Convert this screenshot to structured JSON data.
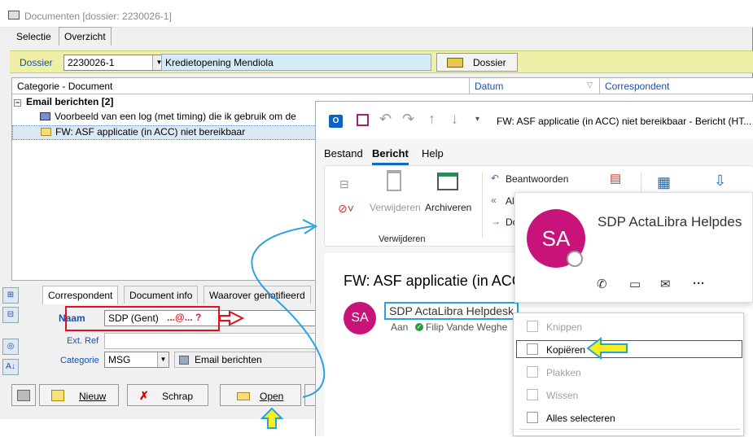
{
  "main_window": {
    "title": "Documenten  [dossier: 2230026-1]",
    "tabs": [
      "Selectie",
      "Overzicht"
    ],
    "dossier": {
      "label": "Dossier",
      "number": "2230026-1",
      "name": "Kredietopening  Mendiola",
      "button": "Dossier"
    },
    "grid": {
      "columns": [
        "Categorie - Document",
        "Datum",
        "Correspondent"
      ],
      "group": "Email berichten [2]",
      "group_toggle": "−",
      "rows": [
        "Voorbeeld van een log (met timing) die ik gebruik om de",
        "FW: ASF applicatie (in ACC) niet bereikbaar"
      ]
    },
    "detail_tabs": [
      "Correspondent",
      "Document info",
      "Waarover genotifieerd"
    ],
    "fields": {
      "naam_label": "Naam",
      "naam_value": "SDP (Gent)",
      "naam_annotation": "...@... ?",
      "extref_label": "Ext. Ref",
      "categorie_label": "Categorie",
      "categorie_value": "MSG",
      "categorie_name": "Email berichten"
    },
    "buttons": [
      "Nieuw",
      "Schrap",
      "Open"
    ]
  },
  "outlook": {
    "window_subject": "FW: ASF applicatie (in ACC) niet bereikbaar  -  Bericht (HT...",
    "tabs": [
      "Bestand",
      "Bericht",
      "Help"
    ],
    "ribbon": {
      "delete": "Verwijderen",
      "archive": "Archiveren",
      "group_label": "Verwijderen",
      "reply": "Beantwoorden",
      "reply_all": "Al",
      "forward": "Do"
    },
    "message": {
      "subject": "FW: ASF applicatie (in ACC",
      "avatar": "SA",
      "sender": "SDP ActaLibra Helpdesk",
      "to_label": "Aan",
      "to": "Filip Vande Weghe"
    },
    "contact_card": {
      "avatar": "SA",
      "name": "SDP ActaLibra Helpdes"
    },
    "context_menu": [
      {
        "label": "Knippen",
        "enabled": false
      },
      {
        "label": "Kopiëren",
        "enabled": true
      },
      {
        "label": "Plakken",
        "enabled": false
      },
      {
        "label": "Wissen",
        "enabled": false
      },
      {
        "label": "Alles selecteren",
        "enabled": true
      }
    ]
  },
  "colors": {
    "dossier_bar": "#eef0a8",
    "accent_blue": "#1a4fb0",
    "avatar": "#c8137b",
    "annotation_red": "#e0101e",
    "annotation_yellow": "#f7ee1e",
    "annotation_cyan": "#29a3e0"
  }
}
